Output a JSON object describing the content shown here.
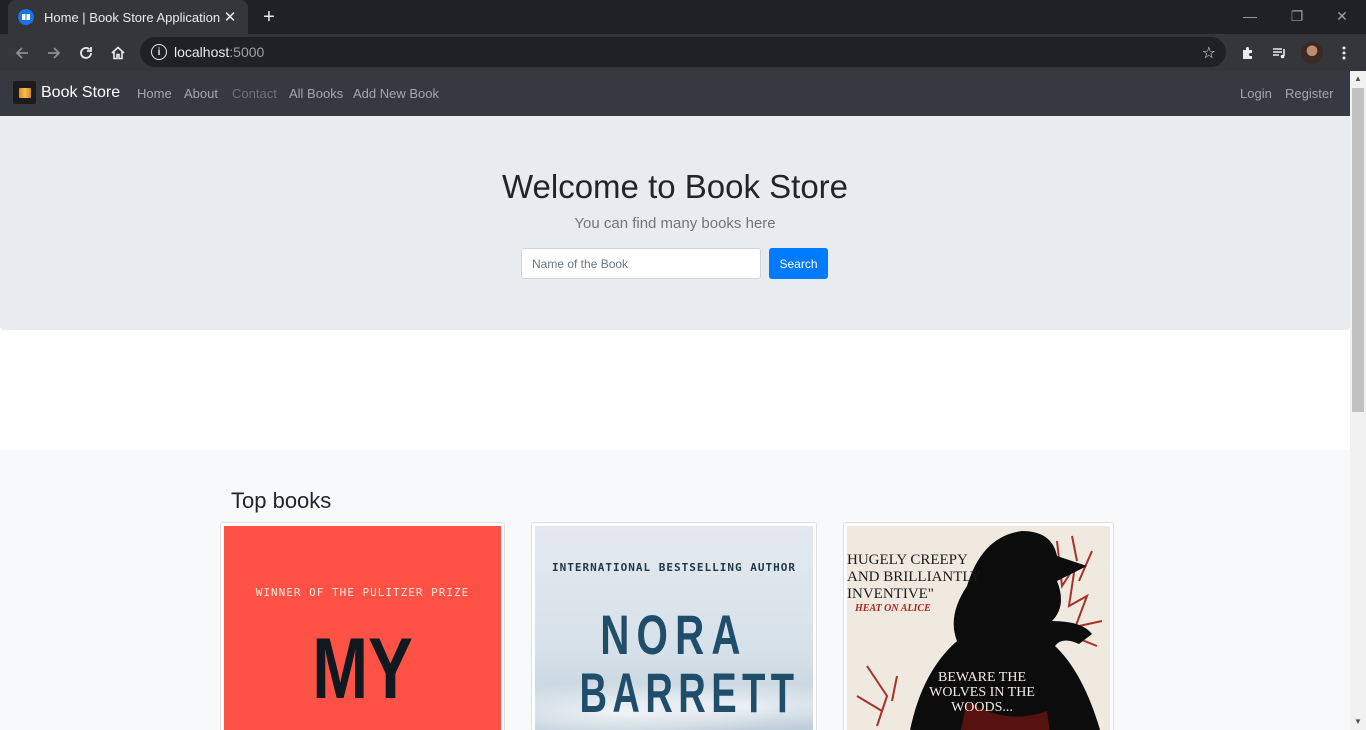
{
  "browser": {
    "tab_title": "Home | Book Store Application",
    "url_host": "localhost",
    "url_port": ":5000"
  },
  "navbar": {
    "brand": "Book Store",
    "links": [
      "Home",
      "About",
      "Contact",
      "All Books",
      "Add New Book"
    ],
    "right_links": [
      "Login",
      "Register"
    ]
  },
  "hero": {
    "title": "Welcome to Book Store",
    "lead": "You can find many books here",
    "search_placeholder": "Name of the Book",
    "search_button": "Search"
  },
  "top_books": {
    "heading": "Top books",
    "covers": [
      {
        "top_text": "WINNER OF THE PULITZER PRIZE",
        "title_text": "MY"
      },
      {
        "top_text": "INTERNATIONAL BESTSELLING AUTHOR",
        "author_first": "NORA",
        "author_last": "BARRETT"
      },
      {
        "quote": "HUGELY CREEPY AND BRILLIANTLY INVENTIVE\"",
        "byline": "HEAT ON ALICE",
        "tagline": "BEWARE THE WOLVES IN THE WOODS..."
      }
    ]
  },
  "colors": {
    "navbar_bg": "#343a40",
    "jumbotron_bg": "#e9ecef",
    "primary": "#007bff"
  }
}
